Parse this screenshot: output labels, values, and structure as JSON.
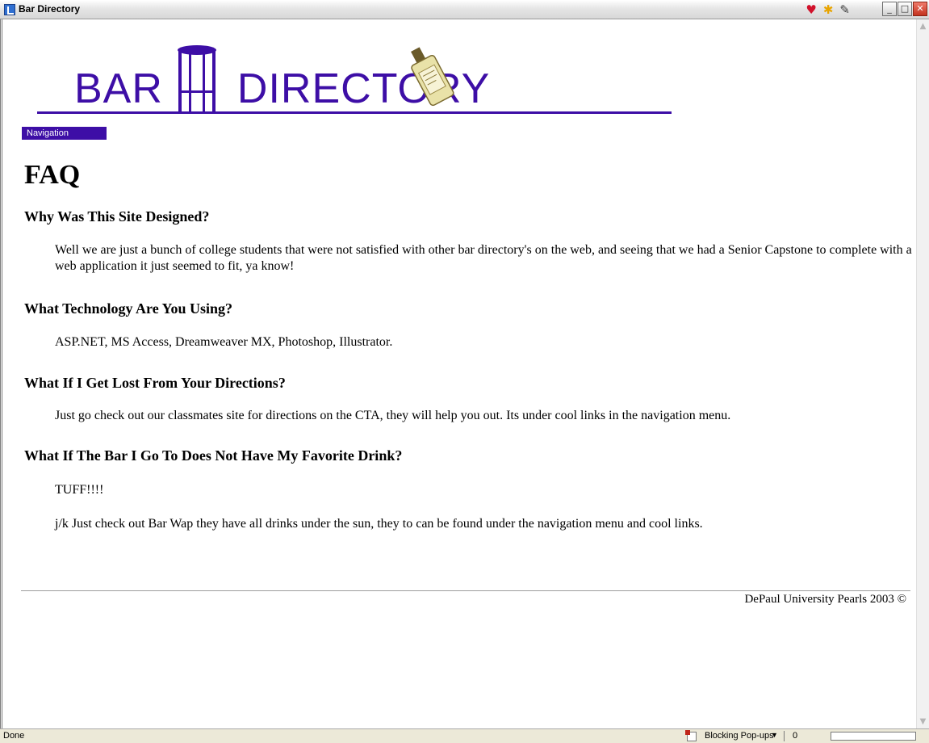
{
  "window": {
    "title": "Bar Directory",
    "icons": [
      "heart-icon",
      "star-icon",
      "edit-icon"
    ]
  },
  "logo": {
    "text_word1": "BAR",
    "text_word2": "DIRECTORY",
    "color": "#3d0ea6"
  },
  "nav": {
    "label": "Navigation"
  },
  "page": {
    "title": "FAQ",
    "faqs": [
      {
        "question": "Why Was This Site Designed?",
        "answers": [
          "Well we are just a bunch of college students that were not satisfied with other bar directory's on the web, and seeing that we had a Senior Capstone to complete with a web application it just seemed to fit, ya know!"
        ]
      },
      {
        "question": "What Technology Are You Using?",
        "answers": [
          "ASP.NET, MS Access, Dreamweaver MX, Photoshop, Illustrator."
        ]
      },
      {
        "question": "What If I Get Lost From Your Directions?",
        "answers": [
          "Just go check out our classmates site for directions on the CTA, they will help you out. Its under cool links in the navigation menu."
        ]
      },
      {
        "question": "What If The Bar I Go To Does Not Have My Favorite Drink?",
        "answers": [
          "TUFF!!!!",
          "j/k Just check out Bar Wap they have all drinks under the sun, they to can be found under the navigation menu and cool links."
        ]
      }
    ]
  },
  "footer": {
    "text": "DePaul University Pearls 2003 ©"
  },
  "statusbar": {
    "status": "Done",
    "popup_label": "Blocking Pop-ups",
    "count": "0"
  }
}
